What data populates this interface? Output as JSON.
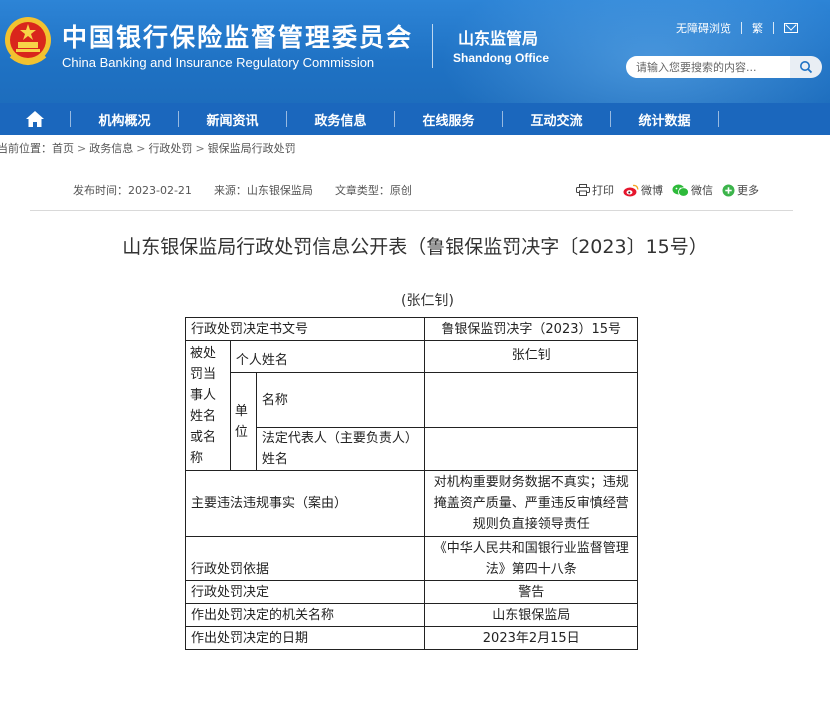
{
  "header": {
    "title_cn": "中国银行保险监督管理委员会",
    "title_en": "China Banking and Insurance Regulatory Commission",
    "branch_cn": "山东监管局",
    "branch_en": "Shandong Office",
    "accessibility_link": "无障碍浏览",
    "traditional_link": "繁",
    "search_placeholder": "请输入您要搜索的内容...",
    "brand_color": "#1f72c4"
  },
  "nav": {
    "items": [
      "机构概况",
      "新闻资讯",
      "政务信息",
      "在线服务",
      "互动交流",
      "统计数据"
    ]
  },
  "breadcrumb": {
    "label": "当前位置：",
    "items": [
      "首页",
      "政务信息",
      "行政处罚",
      "银保监局行政处罚"
    ]
  },
  "meta": {
    "publish_time": "发布时间：2023-02-21",
    "source": "来源：山东银保监局",
    "doc_type": "文章类型：原创"
  },
  "share": {
    "print": "打印",
    "weibo": "微博",
    "wechat": "微信",
    "more": "更多"
  },
  "document": {
    "title": "山东银保监局行政处罚信息公开表（鲁银保监罚决字〔2023〕15号）",
    "subject": "(张仁钊)"
  },
  "table": {
    "doc_number_label": "行政处罚决定书文号",
    "doc_number_value": "鲁银保监罚决字（2023）15号",
    "party_label": "被处罚当事人姓名或名称",
    "person_label": "个人姓名",
    "person_value": "张仁钊",
    "unit_label": "单位",
    "unit_name_label": "名称",
    "unit_name_value": "",
    "legal_rep_label": "法定代表人（主要负责人）姓名",
    "legal_rep_value": "",
    "violation_label": "主要违法违规事实（案由）",
    "violation_value": "对机构重要财务数据不真实；违规掩盖资产质量、严重违反审慎经营规则负直接领导责任",
    "basis_label": "行政处罚依据",
    "basis_value": "《中华人民共和国银行业监督管理法》第四十八条",
    "decision_label": "行政处罚决定",
    "decision_value": "警告",
    "authority_label": "作出处罚决定的机关名称",
    "authority_value": "山东银保监局",
    "date_label": "作出处罚决定的日期",
    "date_value": "2023年2月15日"
  }
}
